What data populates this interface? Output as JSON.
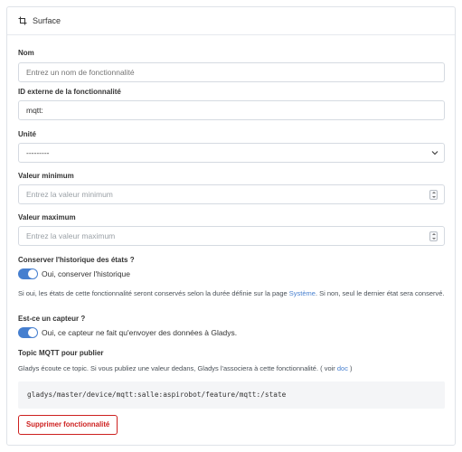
{
  "header": {
    "title": "Surface",
    "icon": "crop-icon"
  },
  "fields": {
    "name": {
      "label": "Nom",
      "placeholder": "Entrez un nom de fonctionnalité",
      "value": ""
    },
    "external_id": {
      "label": "ID externe de la fonctionnalité",
      "value": "mqtt:"
    },
    "unit": {
      "label": "Unité",
      "selected": "---------"
    },
    "min": {
      "label": "Valeur minimum",
      "placeholder": "Entrez la valeur minimum"
    },
    "max": {
      "label": "Valeur maximum",
      "placeholder": "Entrez la valeur maximum"
    }
  },
  "history": {
    "label": "Conserver l'historique des états ?",
    "toggle_label": "Oui, conserver l'historique",
    "toggle_on": true,
    "help_before": "Si oui, les états de cette fonctionnalité seront conservés selon la durée définie sur la page ",
    "help_link": "Système",
    "help_after": ". Si non, seul le dernier état sera conservé."
  },
  "sensor": {
    "label": "Est-ce un capteur ?",
    "toggle_label": "Oui, ce capteur ne fait qu'envoyer des données à Gladys.",
    "toggle_on": true
  },
  "mqtt": {
    "label": "Topic MQTT pour publier",
    "help_before": "Gladys écoute ce topic. Si vous publiez une valeur dedans, Gladys l'associera à cette fonctionnalité. ( voir ",
    "help_link": "doc",
    "help_after": " )",
    "topic": "gladys/master/device/mqtt:salle:aspirobot/feature/mqtt:/state"
  },
  "actions": {
    "delete_label": "Supprimer fonctionnalité"
  },
  "colors": {
    "accent": "#467fcf",
    "danger": "#cd201f"
  }
}
